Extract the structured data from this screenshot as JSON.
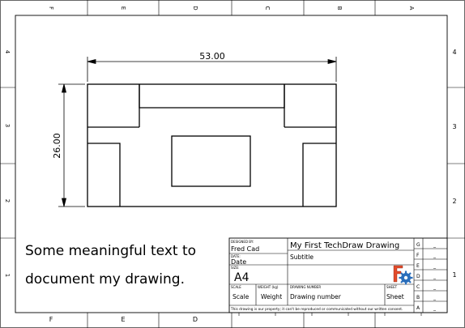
{
  "zones": {
    "top": [
      "F",
      "E",
      "D",
      "C",
      "B",
      "A"
    ],
    "bottom": [
      "F",
      "E",
      "D",
      "C",
      "B",
      "A"
    ],
    "left": [
      "4",
      "3",
      "2",
      "1"
    ],
    "right": [
      "4",
      "3",
      "2",
      "1"
    ]
  },
  "dimensions": {
    "width": "53.00",
    "height": "26.00"
  },
  "notes": {
    "line1": "Some meaningful text to",
    "line2": "document my drawing."
  },
  "title_block": {
    "designed_by_label": "DESIGNED BY:",
    "designed_by": "Fred Cad",
    "date_label": "DATE:",
    "date": "Date",
    "size_label": "SIZE:",
    "size": "A4",
    "title": "My First TechDraw Drawing",
    "subtitle": "Subtitle",
    "scale_label": "SCALE",
    "scale": "Scale",
    "weight_label": "WEIGHT (kg)",
    "weight": "Weight",
    "drawing_number_label": "DRAWING NUMBER",
    "drawing_number": "Drawing number",
    "sheet_label": "SHEET",
    "sheet": "Sheet",
    "copyright": "This drawing is our property; it can't be reproduced or communicated without our written consent.",
    "revisions": [
      {
        "letter": "G",
        "value": "_"
      },
      {
        "letter": "F",
        "value": "_"
      },
      {
        "letter": "E",
        "value": "_"
      },
      {
        "letter": "D",
        "value": "_"
      },
      {
        "letter": "C",
        "value": "_"
      },
      {
        "letter": "B",
        "value": "_"
      },
      {
        "letter": "A",
        "value": "_"
      }
    ]
  },
  "colors": {
    "line": "#000000",
    "logo_red": "#e24b2b",
    "logo_blue": "#2a6ebb"
  }
}
